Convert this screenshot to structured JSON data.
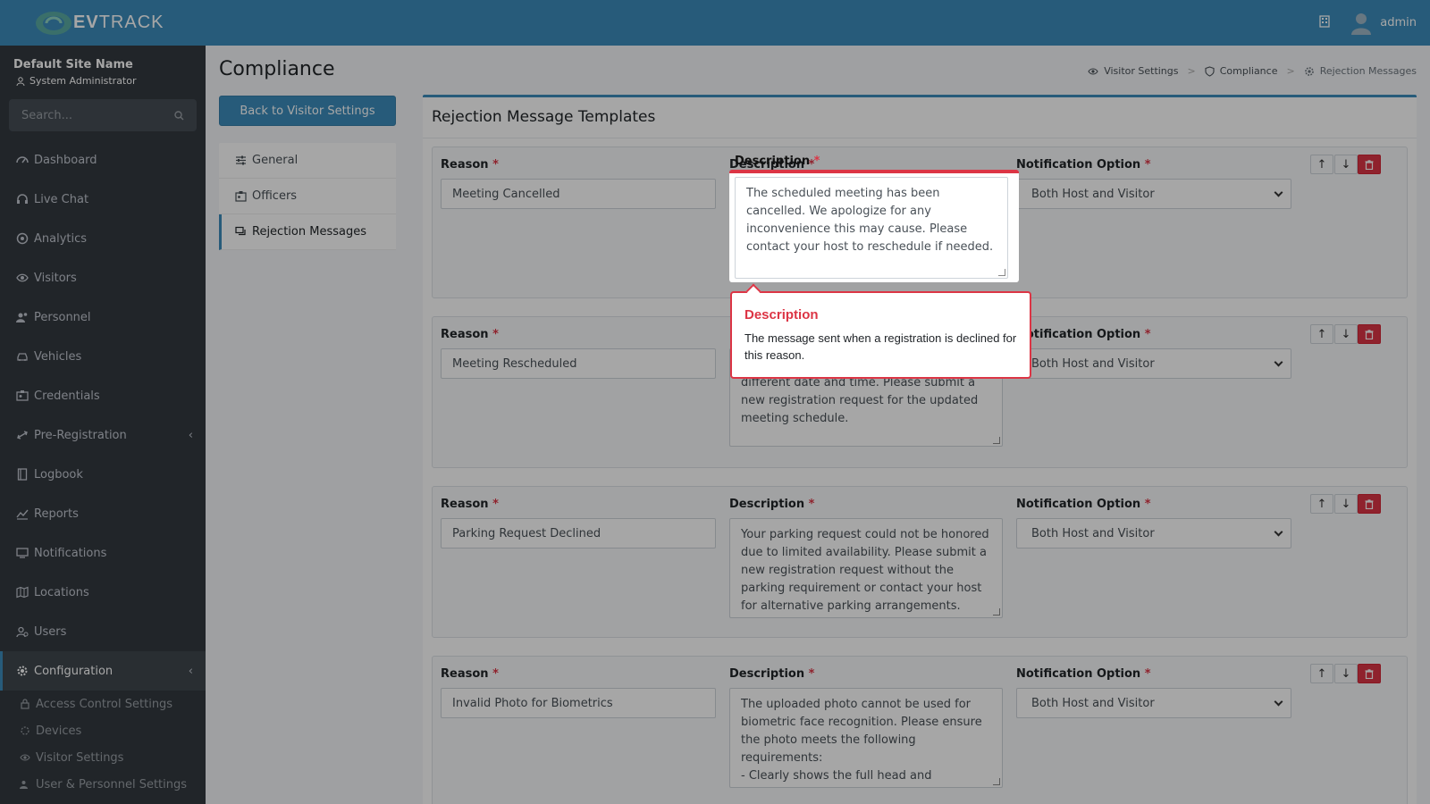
{
  "brand": {
    "name_bold": "EV",
    "name_rest": "TRACK"
  },
  "topbar": {
    "user": "admin",
    "icons": [
      "building-icon",
      "user-avatar-icon"
    ]
  },
  "sidebar": {
    "site_name": "Default Site Name",
    "role": "System Administrator",
    "search_placeholder": "Search...",
    "items": [
      {
        "label": "Dashboard",
        "icon": "dashboard-icon"
      },
      {
        "label": "Live Chat",
        "icon": "headset-icon"
      },
      {
        "label": "Analytics",
        "icon": "target-icon"
      },
      {
        "label": "Visitors",
        "icon": "eye-icon"
      },
      {
        "label": "Personnel",
        "icon": "users-icon"
      },
      {
        "label": "Vehicles",
        "icon": "car-icon"
      },
      {
        "label": "Credentials",
        "icon": "id-card-icon"
      },
      {
        "label": "Pre-Registration",
        "icon": "arrows-icon",
        "expandable": true
      },
      {
        "label": "Logbook",
        "icon": "book-icon"
      },
      {
        "label": "Reports",
        "icon": "chart-icon"
      },
      {
        "label": "Notifications",
        "icon": "bell-icon"
      },
      {
        "label": "Locations",
        "icon": "map-icon"
      },
      {
        "label": "Users",
        "icon": "user-icon"
      },
      {
        "label": "Configuration",
        "icon": "gear-icon",
        "expandable": true,
        "active": true
      }
    ],
    "sub_items": [
      {
        "label": "Access Control Settings",
        "icon": "lock-icon"
      },
      {
        "label": "Devices",
        "icon": "device-icon"
      },
      {
        "label": "Visitor Settings",
        "icon": "eye-icon"
      },
      {
        "label": "User & Personnel Settings",
        "icon": "users-icon"
      }
    ]
  },
  "page": {
    "title": "Compliance",
    "breadcrumb": [
      "Visitor Settings",
      "Compliance",
      "Rejection Messages"
    ],
    "back_button": "Back to Visitor Settings",
    "menu": [
      "General",
      "Officers",
      "Rejection Messages"
    ]
  },
  "card": {
    "title": "Rejection Message Templates",
    "labels": {
      "reason": "Reason",
      "description": "Description",
      "notification": "Notification Option",
      "required": "*"
    },
    "templates": [
      {
        "reason": "Meeting Cancelled",
        "description": "The scheduled meeting has been cancelled. We apologize for any inconvenience this may cause. Please contact your host to reschedule if needed.",
        "notification": "Both Host and Visitor"
      },
      {
        "reason": "Meeting Rescheduled",
        "description": "different date and time. Please submit a new registration request for the updated meeting schedule.",
        "notification": "Both Host and Visitor"
      },
      {
        "reason": "Parking Request Declined",
        "description": "Your parking request could not be honored due to limited availability. Please submit a new registration request without the parking requirement or contact your host for alternative parking arrangements.",
        "notification": "Both Host and Visitor"
      },
      {
        "reason": "Invalid Photo for Biometrics",
        "description": "The uploaded photo cannot be used for biometric face recognition. Please ensure the photo meets the following requirements:\n- Clearly shows the full head and shoulders.\n- Taken against a plain, neutral background.",
        "notification": "Both Host and Visitor"
      }
    ]
  },
  "tooltip": {
    "title": "Description",
    "body": "The message sent when a registration is declined for this reason."
  },
  "colors": {
    "primary": "#3c8dbc",
    "sidebar": "#343a40",
    "danger": "#dc3545"
  }
}
